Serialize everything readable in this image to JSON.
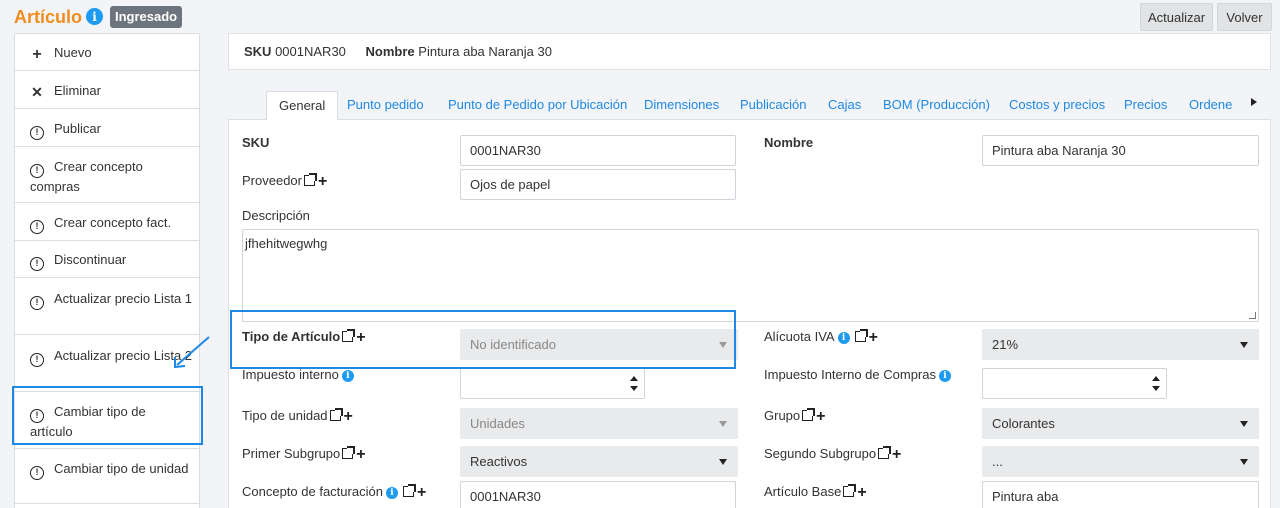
{
  "header": {
    "title": "Artículo",
    "status": "Ingresado",
    "update_button": "Actualizar",
    "back_button": "Volver"
  },
  "sidebar": {
    "items": [
      {
        "label": "Nuevo",
        "icon": "plus-icon"
      },
      {
        "label": "Eliminar",
        "icon": "close-icon"
      },
      {
        "label": "Publicar",
        "icon": "exclamation-circle-icon"
      },
      {
        "label": "Crear concepto compras",
        "icon": "exclamation-circle-icon"
      },
      {
        "label": "Crear concepto fact.",
        "icon": "exclamation-circle-icon"
      },
      {
        "label": "Discontinuar",
        "icon": "exclamation-circle-icon"
      },
      {
        "label": "Actualizar precio Lista 1",
        "icon": "exclamation-circle-icon"
      },
      {
        "label": "Actualizar precio Lista 2",
        "icon": "exclamation-circle-icon"
      },
      {
        "label": "Cambiar tipo de artículo",
        "icon": "exclamation-circle-icon"
      },
      {
        "label": "Cambiar tipo de unidad",
        "icon": "exclamation-circle-icon"
      }
    ]
  },
  "summary": {
    "sku_label": "SKU",
    "sku_value": "0001NAR30",
    "name_label": "Nombre",
    "name_value": "Pintura aba Naranja 30"
  },
  "tabs": [
    "General",
    "Punto pedido",
    "Punto de Pedido por Ubicación",
    "Dimensiones",
    "Publicación",
    "Cajas",
    "BOM (Producción)",
    "Costos y precios",
    "Precios",
    "Ordene"
  ],
  "form": {
    "sku_label": "SKU",
    "sku_value": "0001NAR30",
    "nombre_label": "Nombre",
    "nombre_value": "Pintura aba Naranja 30",
    "proveedor_label": "Proveedor",
    "proveedor_value": "Ojos de papel",
    "descripcion_label": "Descripción",
    "descripcion_value": "jfhehitwegwhg",
    "tipo_articulo_label": "Tipo de Artículo",
    "tipo_articulo_value": "No identificado",
    "alicuota_label": "Alícuota IVA",
    "alicuota_value": "21%",
    "impuesto_interno_label": "Impuesto interno",
    "impuesto_interno_compras_label": "Impuesto Interno de Compras",
    "tipo_unidad_label": "Tipo de unidad",
    "tipo_unidad_value": "Unidades",
    "grupo_label": "Grupo",
    "grupo_value": "Colorantes",
    "primer_subgrupo_label": "Primer Subgrupo",
    "primer_subgrupo_value": "Reactivos",
    "segundo_subgrupo_label": "Segundo Subgrupo",
    "segundo_subgrupo_value": "...",
    "concepto_facturacion_label": "Concepto de facturación",
    "concepto_facturacion_value": "0001NAR30",
    "articulo_base_label": "Artículo Base",
    "articulo_base_value": "Pintura aba"
  },
  "colors": {
    "title": "#f08c1e",
    "link": "#1e88e5",
    "highlight": "#1e88e5",
    "badge": "#6c757d"
  }
}
